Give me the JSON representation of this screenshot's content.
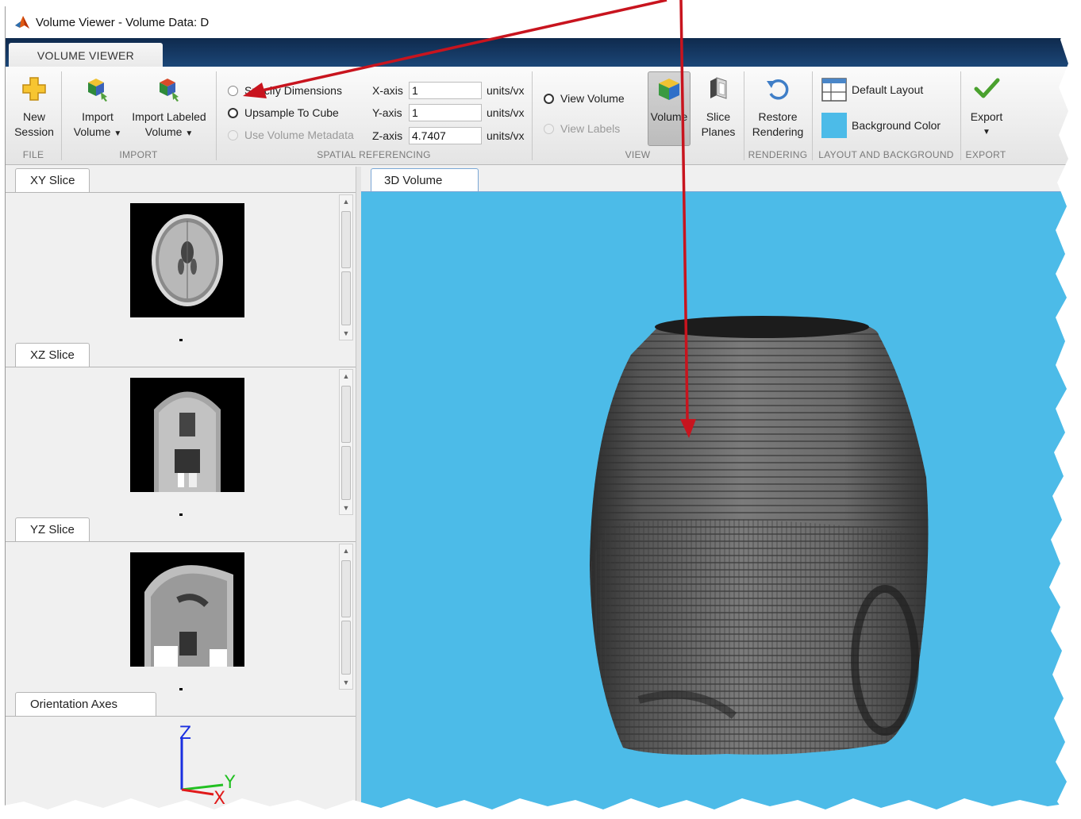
{
  "window": {
    "title": "Volume Viewer - Volume Data: D"
  },
  "toolstrip": {
    "tab_label": "VOLUME VIEWER"
  },
  "file": {
    "group_label": "FILE",
    "new_session": {
      "line1": "New",
      "line2": "Session"
    }
  },
  "import": {
    "group_label": "IMPORT",
    "import_volume": {
      "line1": "Import",
      "line2": "Volume"
    },
    "import_labeled": {
      "line1": "Import Labeled",
      "line2": "Volume"
    }
  },
  "spatial": {
    "group_label": "SPATIAL REFERENCING",
    "options": [
      {
        "label": "Specify Dimensions",
        "selected": false,
        "enabled": true
      },
      {
        "label": "Upsample To Cube",
        "selected": true,
        "enabled": true
      },
      {
        "label": "Use Volume Metadata",
        "selected": false,
        "enabled": false
      }
    ],
    "axes": [
      {
        "label": "X-axis",
        "value": "1",
        "unit": "units/vx"
      },
      {
        "label": "Y-axis",
        "value": "1",
        "unit": "units/vx"
      },
      {
        "label": "Z-axis",
        "value": "4.7407",
        "unit": "units/vx"
      }
    ]
  },
  "view": {
    "group_label": "VIEW",
    "view_volume": "View Volume",
    "view_labels": "View Labels",
    "volume_button": "Volume",
    "slice_planes": {
      "line1": "Slice",
      "line2": "Planes"
    }
  },
  "rendering": {
    "group_label": "RENDERING",
    "restore": {
      "line1": "Restore",
      "line2": "Rendering"
    }
  },
  "layout": {
    "group_label": "LAYOUT AND BACKGROUND",
    "default_layout": "Default Layout",
    "background_color": "Background Color",
    "background_swatch": "#4cbbe8"
  },
  "export": {
    "group_label": "EXPORT",
    "export_label": "Export"
  },
  "panels": {
    "xy": "XY Slice",
    "xz": "XZ Slice",
    "yz": "YZ Slice",
    "orientation": "Orientation Axes",
    "volume": "3D Volume"
  },
  "orientation_axes": {
    "z": "Z",
    "y": "Y",
    "x": "X"
  },
  "colors": {
    "annotation_arrow": "#c8141e",
    "canvas_background": "#4cbbe8",
    "ribbon_header": "#0f2a4d"
  }
}
